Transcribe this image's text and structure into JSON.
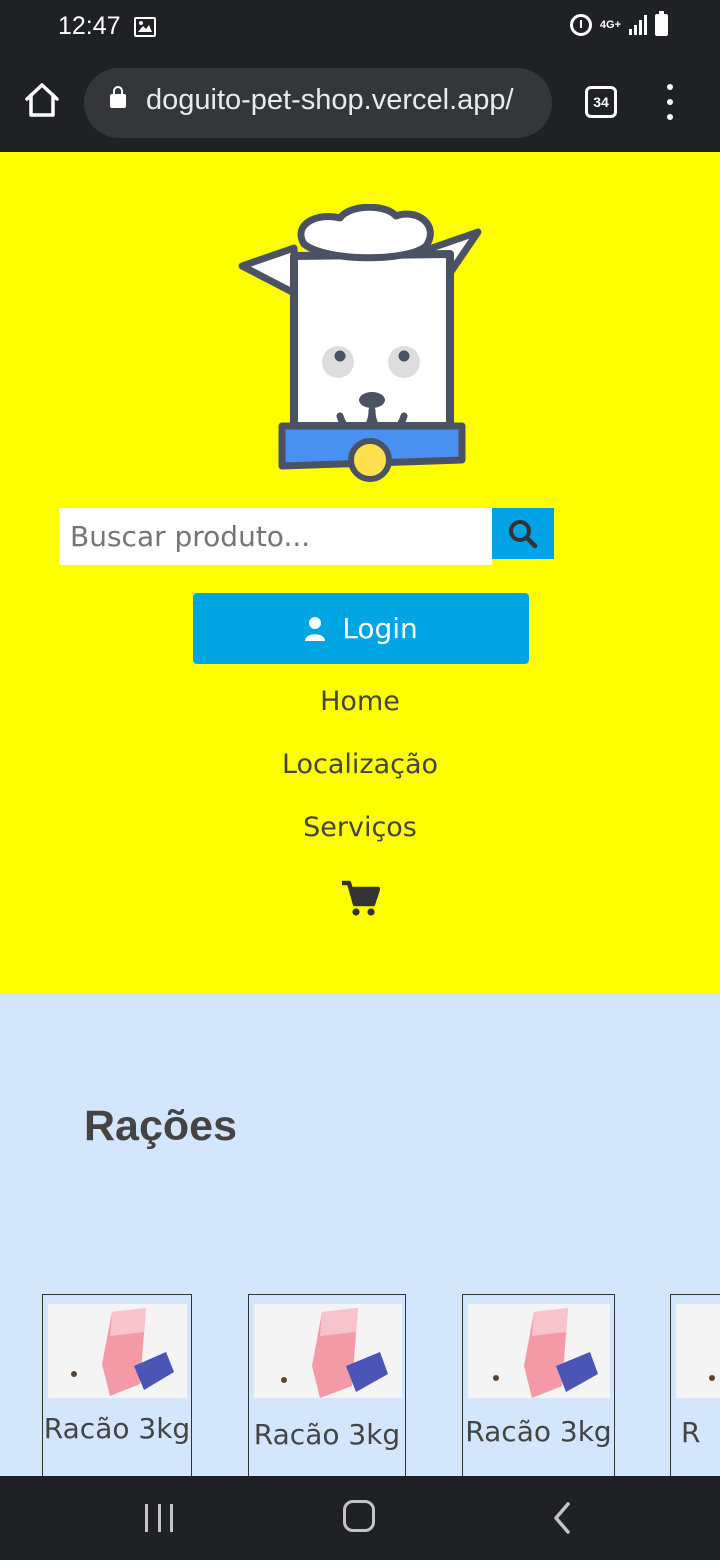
{
  "status_bar": {
    "time": "12:47",
    "network_label": "4G+",
    "icons": [
      "image-icon",
      "alarm-icon",
      "signal-icon",
      "battery-icon"
    ]
  },
  "browser": {
    "url": "doguito-pet-shop.vercel.app/",
    "tab_count": "34",
    "icons": [
      "home-icon",
      "lock-icon",
      "tabs-icon",
      "more-vert-icon"
    ]
  },
  "header": {
    "background_color": "#ffff00",
    "logo_icon": "dog-chef-logo-icon",
    "search": {
      "placeholder": "Buscar produto...",
      "value": "",
      "button_icon": "search-icon"
    },
    "login": {
      "label": "Login",
      "icon": "user-icon",
      "color": "#00a6e4"
    },
    "nav": [
      {
        "label": "Home"
      },
      {
        "label": "Localização"
      },
      {
        "label": "Serviços"
      }
    ],
    "cart_icon": "cart-icon"
  },
  "products": {
    "background_color": "#d3e6fb",
    "title": "Rações",
    "items": [
      {
        "name": "Racão 3kg"
      },
      {
        "name": "Racão 3kg"
      },
      {
        "name": "Racão 3kg"
      },
      {
        "name": "R"
      }
    ]
  },
  "android_nav": {
    "buttons": [
      "recents-icon",
      "home-circle-icon",
      "back-icon"
    ]
  }
}
